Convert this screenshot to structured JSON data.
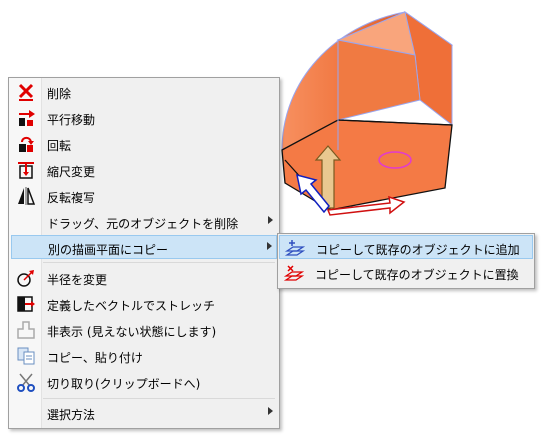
{
  "context_menu": {
    "items": [
      {
        "label": "削除",
        "icon": "delete-x-icon"
      },
      {
        "label": "平行移動",
        "icon": "move-icon"
      },
      {
        "label": "回転",
        "icon": "rotate-icon"
      },
      {
        "label": "縮尺変更",
        "icon": "scale-icon"
      },
      {
        "label": "反転複写",
        "icon": "mirror-copy-icon"
      },
      {
        "label": "ドラッグ、元のオブジェクトを削除",
        "has_submenu": true
      },
      {
        "label": "別の描画平面にコピー",
        "has_submenu": true,
        "selected": true
      },
      {
        "label": "半径を変更",
        "icon": "radius-icon"
      },
      {
        "label": "定義したベクトルでストレッチ",
        "icon": "stretch-icon"
      },
      {
        "label": "非表示 (見えない状態にします)",
        "icon": "hide-icon"
      },
      {
        "label": "コピー、貼り付け",
        "icon": "copy-paste-icon"
      },
      {
        "label": "切り取り(クリップボードへ)",
        "icon": "cut-icon"
      },
      {
        "label": "選択方法",
        "has_submenu": true
      }
    ]
  },
  "submenu": {
    "items": [
      {
        "label": "コピーして既存のオブジェクトに追加",
        "icon": "copy-add-icon",
        "selected": true
      },
      {
        "label": "コピーして既存のオブジェクトに置換",
        "icon": "copy-replace-icon"
      }
    ]
  },
  "colors": {
    "menu_bg": "#f0f0f0",
    "highlight": "#cce4f7",
    "model_orange": "#f47a45",
    "icon_red": "#e00000"
  }
}
